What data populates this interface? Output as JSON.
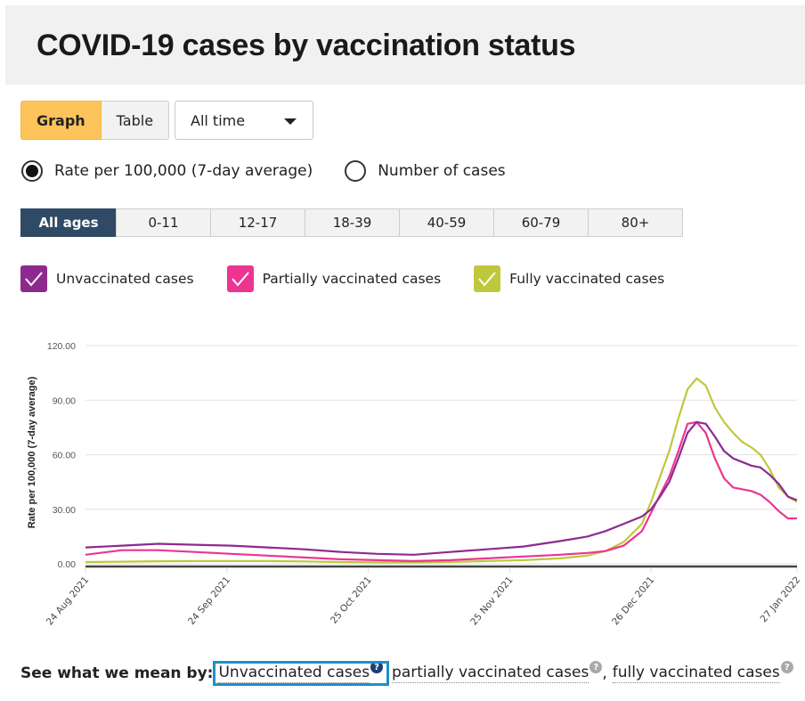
{
  "header": {
    "title": "COVID-19 cases by vaccination status"
  },
  "view_toggle": {
    "graph_label": "Graph",
    "table_label": "Table",
    "active": "Graph"
  },
  "time_select": {
    "value": "All time"
  },
  "measure": {
    "options": [
      {
        "label": "Rate per 100,000 (7-day average)",
        "checked": true
      },
      {
        "label": "Number of cases",
        "checked": false
      }
    ]
  },
  "age_tabs": {
    "items": [
      "All ages",
      "0-11",
      "12-17",
      "18-39",
      "40-59",
      "60-79",
      "80+"
    ],
    "active": "All ages"
  },
  "legend": {
    "items": [
      {
        "label": "Unvaccinated cases",
        "color": "#8e2a8f",
        "checked": true
      },
      {
        "label": "Partially vaccinated cases",
        "color": "#ec3591",
        "checked": true
      },
      {
        "label": "Fully vaccinated cases",
        "color": "#bfc83c",
        "checked": true
      }
    ]
  },
  "chart_data": {
    "type": "line",
    "title": "",
    "xlabel": "",
    "ylabel": "Rate per 100,000 (7-day average)",
    "ylim": [
      0,
      120
    ],
    "yticks": [
      "0.00",
      "30.00",
      "60.00",
      "90.00",
      "120.00"
    ],
    "xticks": [
      "24 Aug 2021",
      "24 Sep 2021",
      "25 Oct 2021",
      "25 Nov 2021",
      "26 Dec 2021",
      "27 Jan 2022"
    ],
    "x_days_range": [
      0,
      156
    ],
    "xtick_days": [
      0,
      31,
      62,
      93,
      124,
      156
    ],
    "grid": true,
    "x": [
      0,
      8,
      16,
      24,
      32,
      40,
      48,
      56,
      64,
      72,
      80,
      88,
      96,
      104,
      110,
      114,
      118,
      122,
      124,
      126,
      128,
      130,
      132,
      134,
      136,
      138,
      140,
      142,
      144,
      146,
      148,
      150,
      152,
      154,
      156
    ],
    "series": [
      {
        "name": "Unvaccinated cases",
        "color": "#8e2a8f",
        "values": [
          9,
          10,
          11,
          10.5,
          10,
          9,
          8,
          6.5,
          5.5,
          5,
          6.5,
          8,
          9.5,
          12.5,
          15,
          18,
          22,
          26,
          30,
          37,
          45,
          58,
          72,
          78,
          77,
          70,
          62,
          58,
          56,
          54,
          53,
          49,
          44,
          37,
          35
        ]
      },
      {
        "name": "Partially vaccinated cases",
        "color": "#ec3591",
        "values": [
          5,
          7.5,
          7.5,
          6.5,
          5.5,
          4.5,
          3.5,
          2.5,
          2,
          1.5,
          2,
          3,
          4,
          5,
          6,
          7,
          10,
          18,
          28,
          38,
          48,
          62,
          77,
          78,
          72,
          58,
          47,
          42,
          41,
          40,
          38,
          34,
          29,
          25,
          25
        ]
      },
      {
        "name": "Fully vaccinated cases",
        "color": "#bfc83c",
        "values": [
          1,
          1.2,
          1.4,
          1.5,
          1.5,
          1.5,
          1.3,
          1,
          0.8,
          0.8,
          1,
          1.5,
          2,
          3,
          4.5,
          7,
          12,
          22,
          34,
          48,
          62,
          80,
          96,
          102,
          98,
          86,
          78,
          72,
          67,
          64,
          60,
          52,
          42,
          37,
          34
        ]
      }
    ]
  },
  "footer": {
    "label": "See what we mean by:",
    "terms": [
      "Unvaccinated cases",
      "partially vaccinated cases",
      "fully vaccinated cases"
    ],
    "separator": ",",
    "help_glyph": "?"
  }
}
